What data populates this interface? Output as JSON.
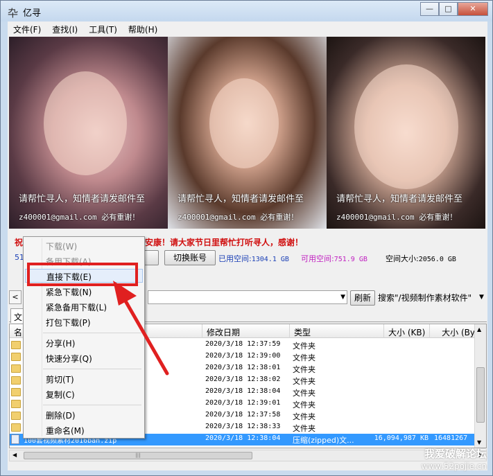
{
  "window": {
    "app_icon": "卆",
    "title": "亿寻",
    "buttons": {
      "minimize": "—",
      "maximize": "□",
      "close": "✕"
    }
  },
  "menubar": [
    {
      "label": "文件(F)"
    },
    {
      "label": "查找(I)"
    },
    {
      "label": "工具(T)"
    },
    {
      "label": "帮助(H)"
    }
  ],
  "photos": [
    {
      "line1": "请帮忙寻人，知情者请发邮件至",
      "line2": "z400001@gmail.com 必有重谢！"
    },
    {
      "line1": "请帮忙寻人，知情者请发邮件至",
      "line2": "z400001@gmail.com 必有重谢！"
    },
    {
      "line1": "请帮忙寻人，知情者请发邮件至",
      "line2": "z400001@gmail.com 必有重谢！"
    }
  ],
  "notice": {
    "prefix": "祝",
    "text": "平安康！请大家节日里帮忙打听寻人，感谢！"
  },
  "account": {
    "number_prefix": "51",
    "switch_button": "切换账号",
    "used_label": "已用空间:",
    "used_value": "1304.1 GB",
    "avail_label": "可用空间:",
    "avail_value": "751.9 GB",
    "total_label": "空间大小:",
    "total_value": "2056.0 GB"
  },
  "search": {
    "back_label": "<",
    "refresh_button": "刷新",
    "search_label": "搜索\"/视频制作素材软件\""
  },
  "tab": {
    "label": "文"
  },
  "file_list": {
    "columns": [
      "名",
      "修改日期",
      "类型",
      "大小 (KB)",
      "大小 (By"
    ],
    "rows": [
      {
        "icon": "folder",
        "name": "",
        "date": "2020/3/18 12:37:59",
        "type": "文件夹",
        "size_kb": "",
        "size_b": ""
      },
      {
        "icon": "folder",
        "name": "",
        "date": "2020/3/18 12:39:00",
        "type": "文件夹",
        "size_kb": "",
        "size_b": ""
      },
      {
        "icon": "folder",
        "name": "",
        "date": "2020/3/18 12:38:01",
        "type": "文件夹",
        "size_kb": "",
        "size_b": ""
      },
      {
        "icon": "folder",
        "name": "",
        "date": "2020/3/18 12:38:02",
        "type": "文件夹",
        "size_kb": "",
        "size_b": ""
      },
      {
        "icon": "folder",
        "name": "",
        "date": "2020/3/18 12:38:04",
        "type": "文件夹",
        "size_kb": "",
        "size_b": ""
      },
      {
        "icon": "folder",
        "name": "",
        "date": "2020/3/18 12:39:01",
        "type": "文件夹",
        "size_kb": "",
        "size_b": ""
      },
      {
        "icon": "folder",
        "name": "",
        "date": "2020/3/18 12:37:58",
        "type": "文件夹",
        "size_kb": "",
        "size_b": ""
      },
      {
        "icon": "folder",
        "name": "",
        "date": "2020/3/18 12:38:33",
        "type": "文件夹",
        "size_kb": "",
        "size_b": ""
      },
      {
        "icon": "file",
        "name": "100套视频素材2016ban.zip",
        "date": "2020/3/18 12:38:04",
        "type": "压缩(zipped)文...",
        "size_kb": "16,094,987 KB",
        "size_b": "16481267",
        "selected": true
      }
    ]
  },
  "context_menu": {
    "items": [
      {
        "label": "下载(W)",
        "disabled": true
      },
      {
        "label": "备用下载(A)",
        "disabled": true
      },
      {
        "label": "直接下载(E)",
        "hot": true
      },
      {
        "label": "紧急下载(N)"
      },
      {
        "label": "紧急备用下载(L)"
      },
      {
        "label": "打包下载(P)"
      },
      {
        "label": "分享(H)"
      },
      {
        "label": "快速分享(Q)"
      },
      {
        "label": "剪切(T)"
      },
      {
        "label": "复制(C)"
      },
      {
        "label": "删除(D)"
      },
      {
        "label": "重命名(M)"
      }
    ]
  },
  "watermark": {
    "line1": "我爱破解论坛",
    "line2": "www.52pojie.cn"
  },
  "colors": {
    "annotation": "#e02020",
    "notice": "#d01010",
    "selection": "#3399ff"
  }
}
